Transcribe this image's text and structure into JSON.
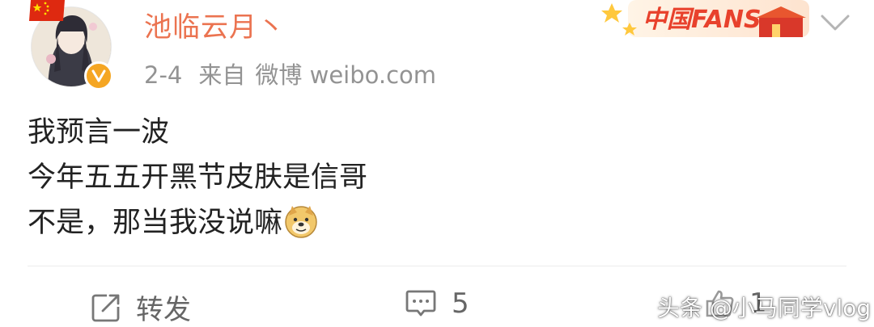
{
  "post": {
    "username": "池临云月丶",
    "date": "2-4",
    "source_prefix": "来自",
    "source": "微博 weibo.com",
    "badge_text": "中国FANS",
    "content_lines": [
      "我预言一波",
      "今年五五开黑节皮肤是信哥",
      "不是，那当我没说嘛"
    ],
    "emoji": "doge-emoji"
  },
  "actions": {
    "repost_label": "转发",
    "comment_count": "5",
    "like_count": "1"
  },
  "watermark": "头条 @小马同学vlog",
  "colors": {
    "username": "#eb7350",
    "meta": "#939393",
    "verified": "#f5a623",
    "badge": "#e8412c"
  }
}
